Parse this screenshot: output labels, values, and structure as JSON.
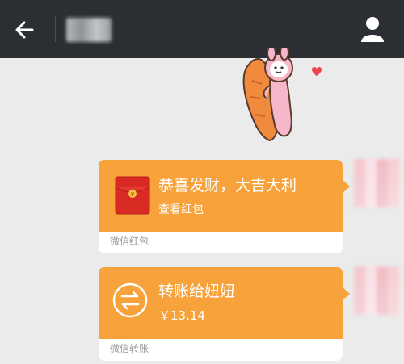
{
  "header": {
    "back_icon": "arrow-left-icon",
    "profile_icon": "person-icon",
    "colors": {
      "bar": "#2b2e33",
      "icon": "#ffffff"
    }
  },
  "messages": {
    "sticker": {
      "icon": "carrot-hug-sticker"
    },
    "red_packet": {
      "title": "恭喜发财，大吉大利",
      "subtitle": "查看红包",
      "footer": "微信红包",
      "icon": "red-envelope-icon"
    },
    "transfer": {
      "title": "转账给妞妞",
      "amount": "￥13.14",
      "footer": "微信转账",
      "icon": "transfer-arrows-icon"
    }
  },
  "colors": {
    "bubble": "#f7a23a",
    "red_envelope": "#d92b23",
    "background": "#ebebeb"
  }
}
